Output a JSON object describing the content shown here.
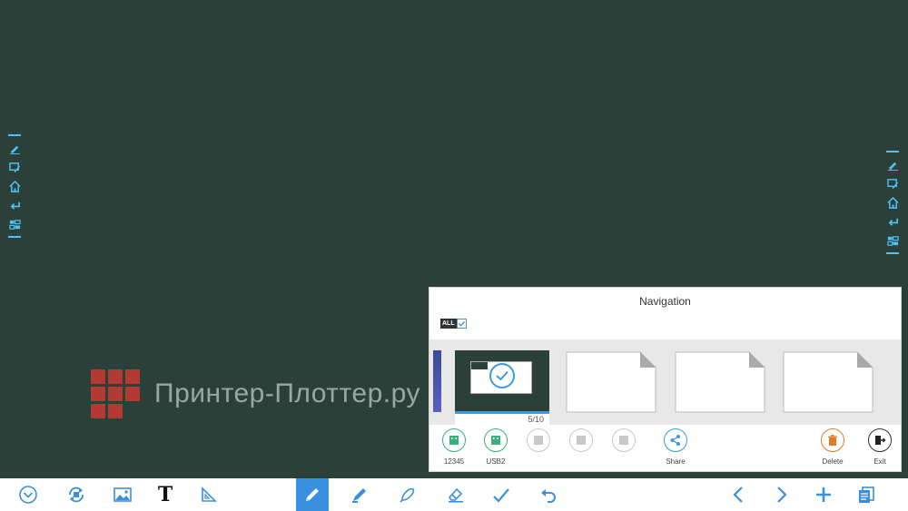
{
  "navigation": {
    "title": "Navigation",
    "all_label": "ALL",
    "current_page": "5/10",
    "actions": [
      {
        "id": "usb-12345",
        "label": "12345"
      },
      {
        "id": "usb2",
        "label": "USB2"
      },
      {
        "id": "slot3",
        "label": ""
      },
      {
        "id": "slot4",
        "label": ""
      },
      {
        "id": "slot5",
        "label": ""
      },
      {
        "id": "share",
        "label": "Share"
      },
      {
        "id": "delete",
        "label": "Delete"
      },
      {
        "id": "exit",
        "label": "Exit"
      }
    ]
  },
  "watermark": {
    "text": "Принтер-Плоттер.ру"
  },
  "colors": {
    "board": "#2a4038",
    "accent": "#3b8fe0",
    "side_icon": "#4fc3f7",
    "usb_green": "#3ab07a",
    "delete_orange": "#e07b2a",
    "watermark_red": "#b23a32"
  },
  "side_toolbar_icons": [
    "pen-icon",
    "screen-annotate-icon",
    "home-icon",
    "return-icon",
    "windows-icon"
  ],
  "bottom_toolbar_icons": [
    "menu-chevron-icon",
    "rotate-capture-icon",
    "image-icon",
    "text-icon",
    "ruler-icon",
    "pen-icon",
    "marker-icon",
    "brush-icon",
    "eraser-icon",
    "select-icon",
    "undo-icon",
    "previous-page-icon",
    "next-page-icon",
    "add-page-icon",
    "page-list-icon"
  ]
}
